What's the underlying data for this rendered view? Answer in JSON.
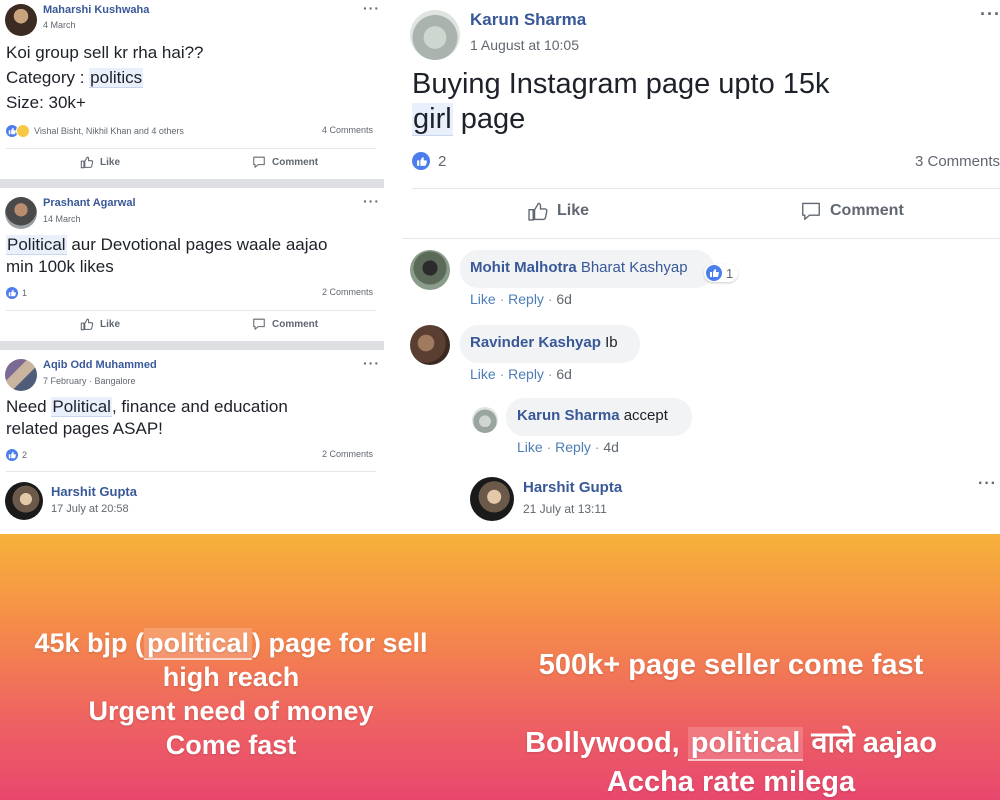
{
  "left_feed": {
    "posts": [
      {
        "author": "Maharshi Kushwaha",
        "date": "4 March",
        "line1": "Koi group sell kr rha hai??",
        "line2_prefix": "Category : ",
        "line2_highlight": "politics",
        "line3": "Size: 30k+",
        "reactions_text": "Vishal Bisht, Nikhil Khan and 4 others",
        "comments_count": "4 Comments",
        "like_label": "Like",
        "comment_label": "Comment"
      },
      {
        "author": "Prashant Agarwal",
        "date": "14 March",
        "text_highlight": "Political",
        "text_rest_1": " aur Devotional pages waale aajao",
        "text_line2": "min 100k likes",
        "reactions_count": "1",
        "comments_count": "2 Comments",
        "like_label": "Like",
        "comment_label": "Comment"
      },
      {
        "author": "Aqib Odd Muhammed",
        "date": "7 February · Bangalore",
        "text_prefix": "Need ",
        "text_highlight": "Political",
        "text_rest_1": ", finance and education",
        "text_line2": "related pages ASAP!",
        "reactions_count": "2",
        "comments_count": "2 Comments"
      }
    ],
    "harshit": {
      "author": "Harshit Gupta",
      "date": "17 July at 20:58"
    },
    "promo": {
      "line1_prefix": "45k bjp (",
      "line1_highlight": "political",
      "line1_suffix": ") page for sell",
      "line2": "high reach",
      "line3": "Urgent need of money",
      "line4": "Come fast"
    }
  },
  "right_feed": {
    "post": {
      "author": "Karun Sharma",
      "date": "1 August at 10:05",
      "text_line1": "Buying Instagram page upto 15k",
      "text_highlight": "girl",
      "text_rest": " page",
      "reactions_count": "2",
      "comments_count": "3 Comments",
      "like_label": "Like",
      "comment_label": "Comment"
    },
    "comments": [
      {
        "author": "Mohit Malhotra",
        "text": "Bharat Kashyap",
        "reaction_count": "1",
        "like": "Like",
        "reply": "Reply",
        "time": "6d"
      },
      {
        "author": "Ravinder Kashyap",
        "text": "Ib",
        "like": "Like",
        "reply": "Reply",
        "time": "6d"
      },
      {
        "author": "Karun Sharma",
        "text": "accept",
        "like": "Like",
        "reply": "Reply",
        "time": "4d"
      }
    ],
    "harshit": {
      "author": "Harshit Gupta",
      "date": "21 July at 13:11"
    },
    "promo": {
      "line1": "500k+ page seller come fast",
      "line2_prefix": "Bollywood, ",
      "line2_highlight": "political",
      "line2_suffix": " वाले aajao",
      "line3": "Accha rate milega"
    }
  },
  "colors": {
    "facebook_link": "#385898",
    "like_blue": "#4b7ded",
    "promo_gradient_top": "#f7b23a",
    "promo_gradient_bottom": "#e8476e"
  }
}
